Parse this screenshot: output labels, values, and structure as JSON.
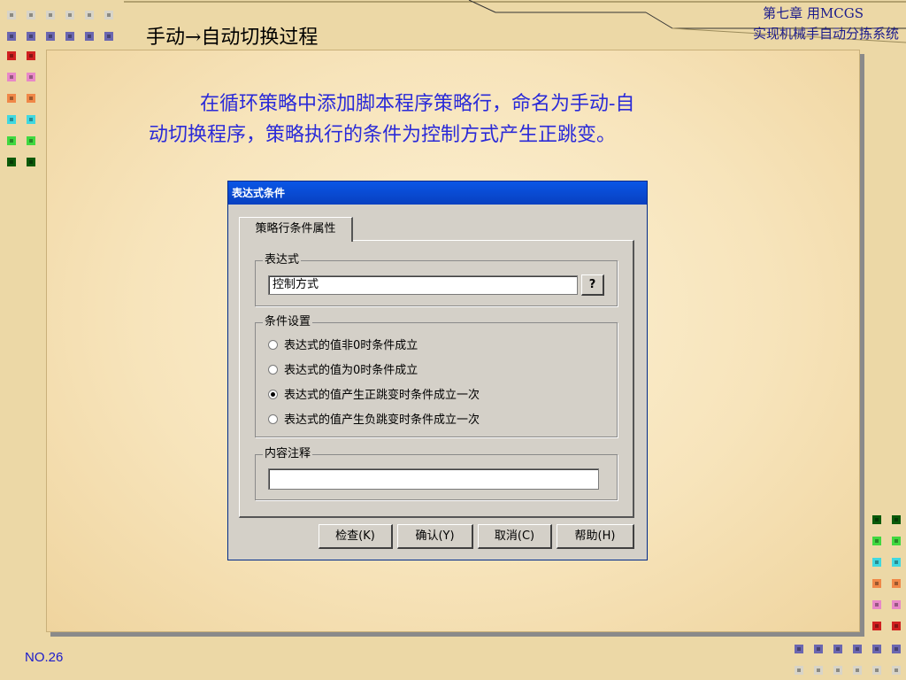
{
  "slide": {
    "title": "手动→自动切换过程",
    "chapter_line1": "第七章 用MCGS",
    "chapter_line2": "实现机械手自动分拣系统",
    "intro_line1": "在循环策略中添加脚本程序策略行，命名为手动-自",
    "intro_line2": "动切换程序，策略执行的条件为控制方式产生正跳变。",
    "page_number": "NO.26"
  },
  "dialog": {
    "title": "表达式条件",
    "tab_label": "策略行条件属性",
    "expression_group_label": "表达式",
    "expression_value": "控制方式",
    "expression_help_button": "?",
    "condition_group_label": "条件设置",
    "options": [
      {
        "label": "表达式的值非0时条件成立",
        "selected": false
      },
      {
        "label": "表达式的值为0时条件成立",
        "selected": false
      },
      {
        "label": "表达式的值产生正跳变时条件成立一次",
        "selected": true
      },
      {
        "label": "表达式的值产生负跳变时条件成立一次",
        "selected": false
      }
    ],
    "comment_group_label": "内容注释",
    "comment_value": "",
    "buttons": {
      "check": "检查(K)",
      "confirm": "确认(Y)",
      "cancel": "取消(C)",
      "help": "帮助(H)"
    }
  },
  "colors": {
    "background": "#ecd8a6",
    "intro_text": "#2a2ad8",
    "titlebar": "#0a56e6"
  }
}
